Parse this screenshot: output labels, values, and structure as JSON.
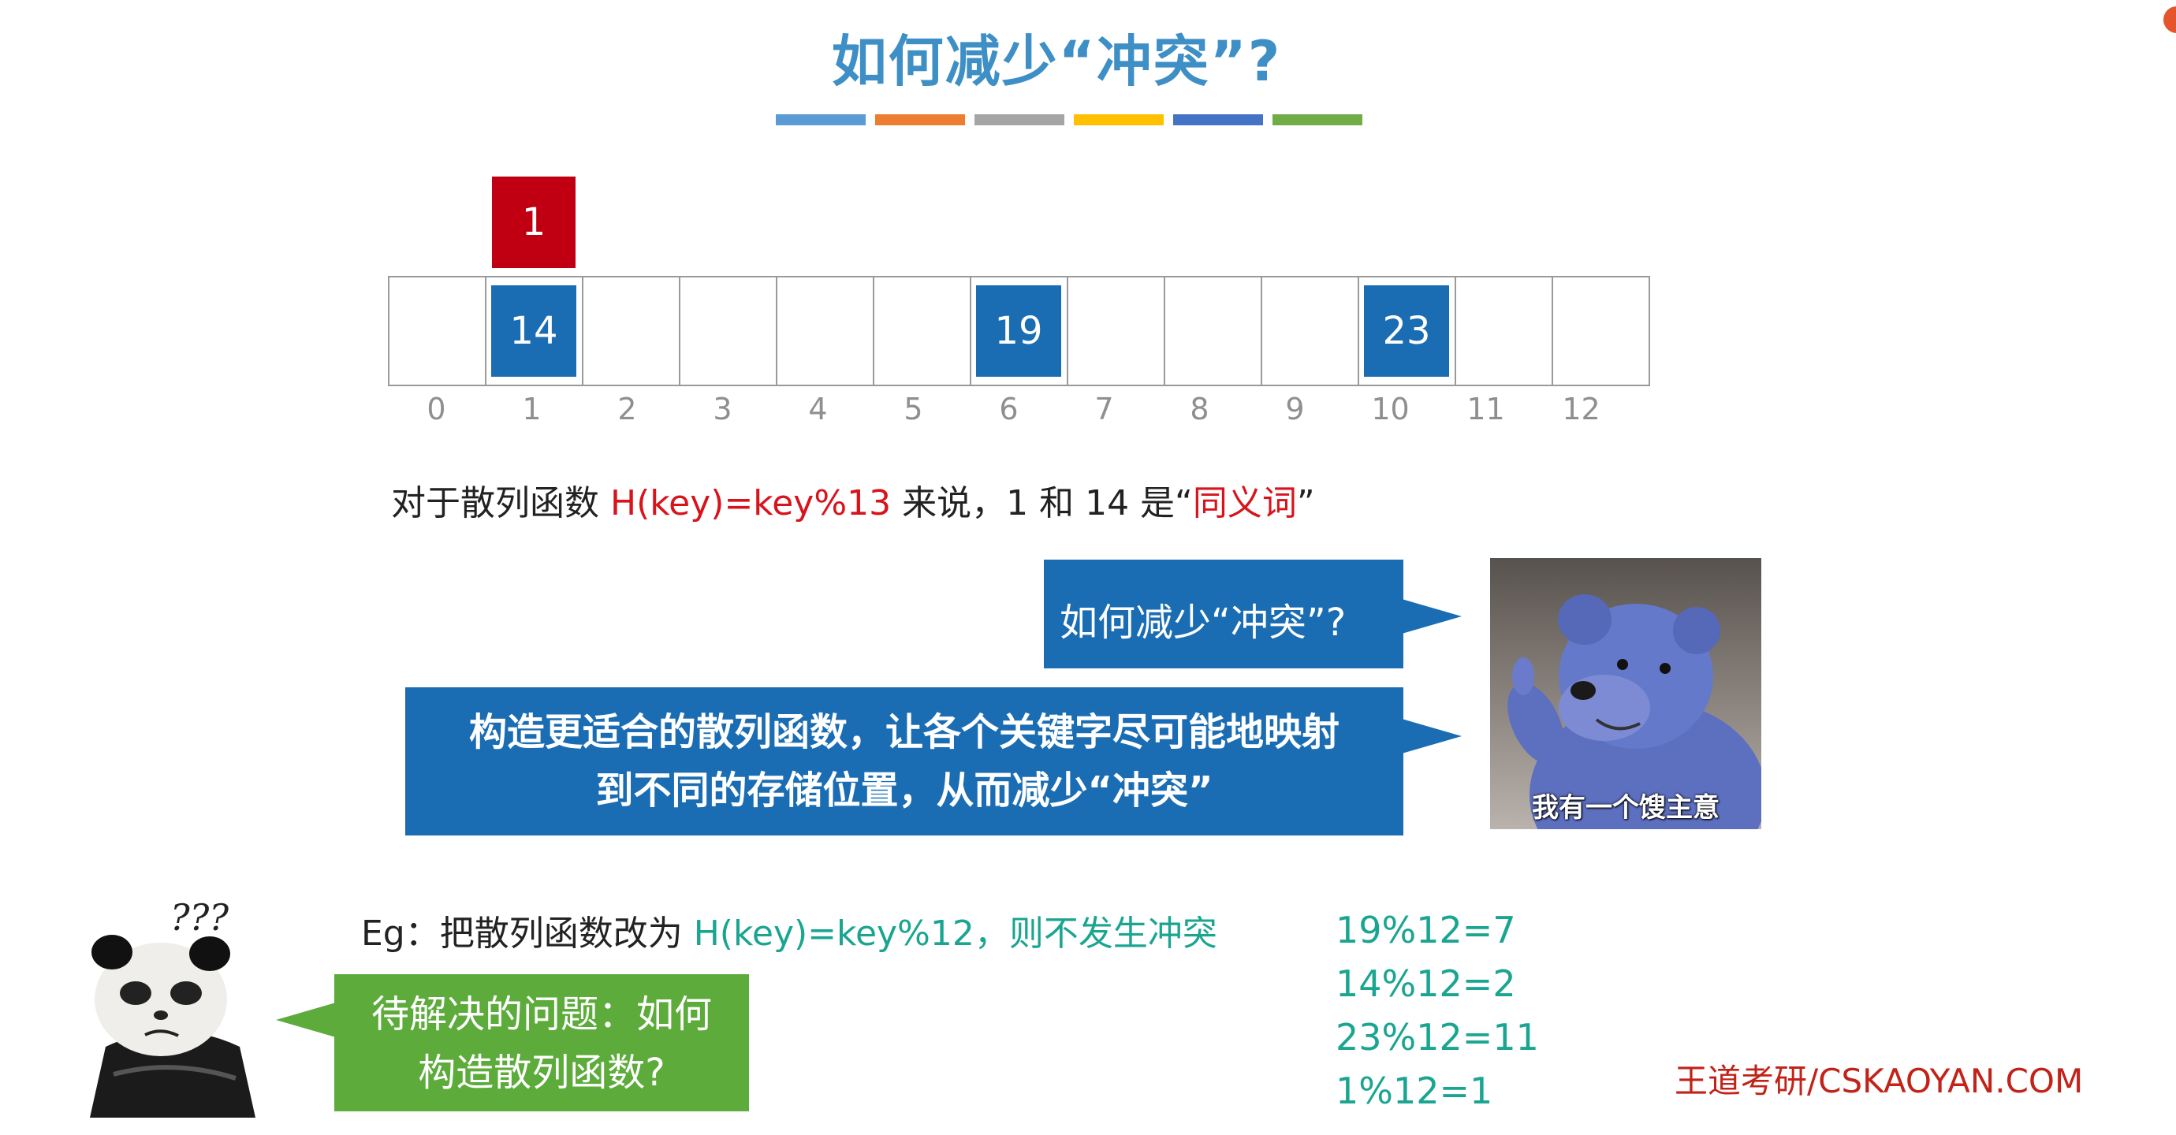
{
  "title": "如何减少“冲突”?",
  "title_bar_colors": [
    "#5b9bd5",
    "#ed7d31",
    "#a5a5a5",
    "#ffc000",
    "#4472c4",
    "#70ad47"
  ],
  "hash_table": {
    "cells": [
      "",
      "14",
      "",
      "",
      "",
      "",
      "19",
      "",
      "",
      "",
      "23",
      "",
      ""
    ],
    "indices": [
      "0",
      "1",
      "2",
      "3",
      "4",
      "5",
      "6",
      "7",
      "8",
      "9",
      "10",
      "11",
      "12"
    ],
    "collision_key": "1",
    "collision_slot": 1
  },
  "sentence": {
    "prefix": "对于散列函数 ",
    "function": "H(key)=key%13",
    "middle": " 来说，1 和 14 是“",
    "term": "同义词",
    "suffix": "”"
  },
  "bubbles": {
    "question": "如何减少“冲突”?",
    "answer_line1": "构造更适合的散列函数，让各个关键字尽可能地映射",
    "answer_line2": "到不同的存储位置，从而减少“冲突”",
    "pending_line1": "待解决的问题：如何",
    "pending_line2": "构造散列函数?"
  },
  "meme": {
    "bear_caption": "我有一个馊主意",
    "panda_text": "???"
  },
  "example": {
    "prefix": "Eg：把散列函数改为 ",
    "highlight": "H(key)=key%12，则不发生冲突"
  },
  "calculations": [
    "19%12=7",
    "14%12=2",
    "23%12=11",
    "1%12=1"
  ],
  "footer": "王道考研/CSKAOYAN.COM",
  "colors": {
    "title": "#3d8fc6",
    "cell_fill": "#1b6db3",
    "collision": "#c00012",
    "highlight_red": "#d8131b",
    "highlight_teal": "#1aa591",
    "bubble_green": "#5cab3b"
  }
}
